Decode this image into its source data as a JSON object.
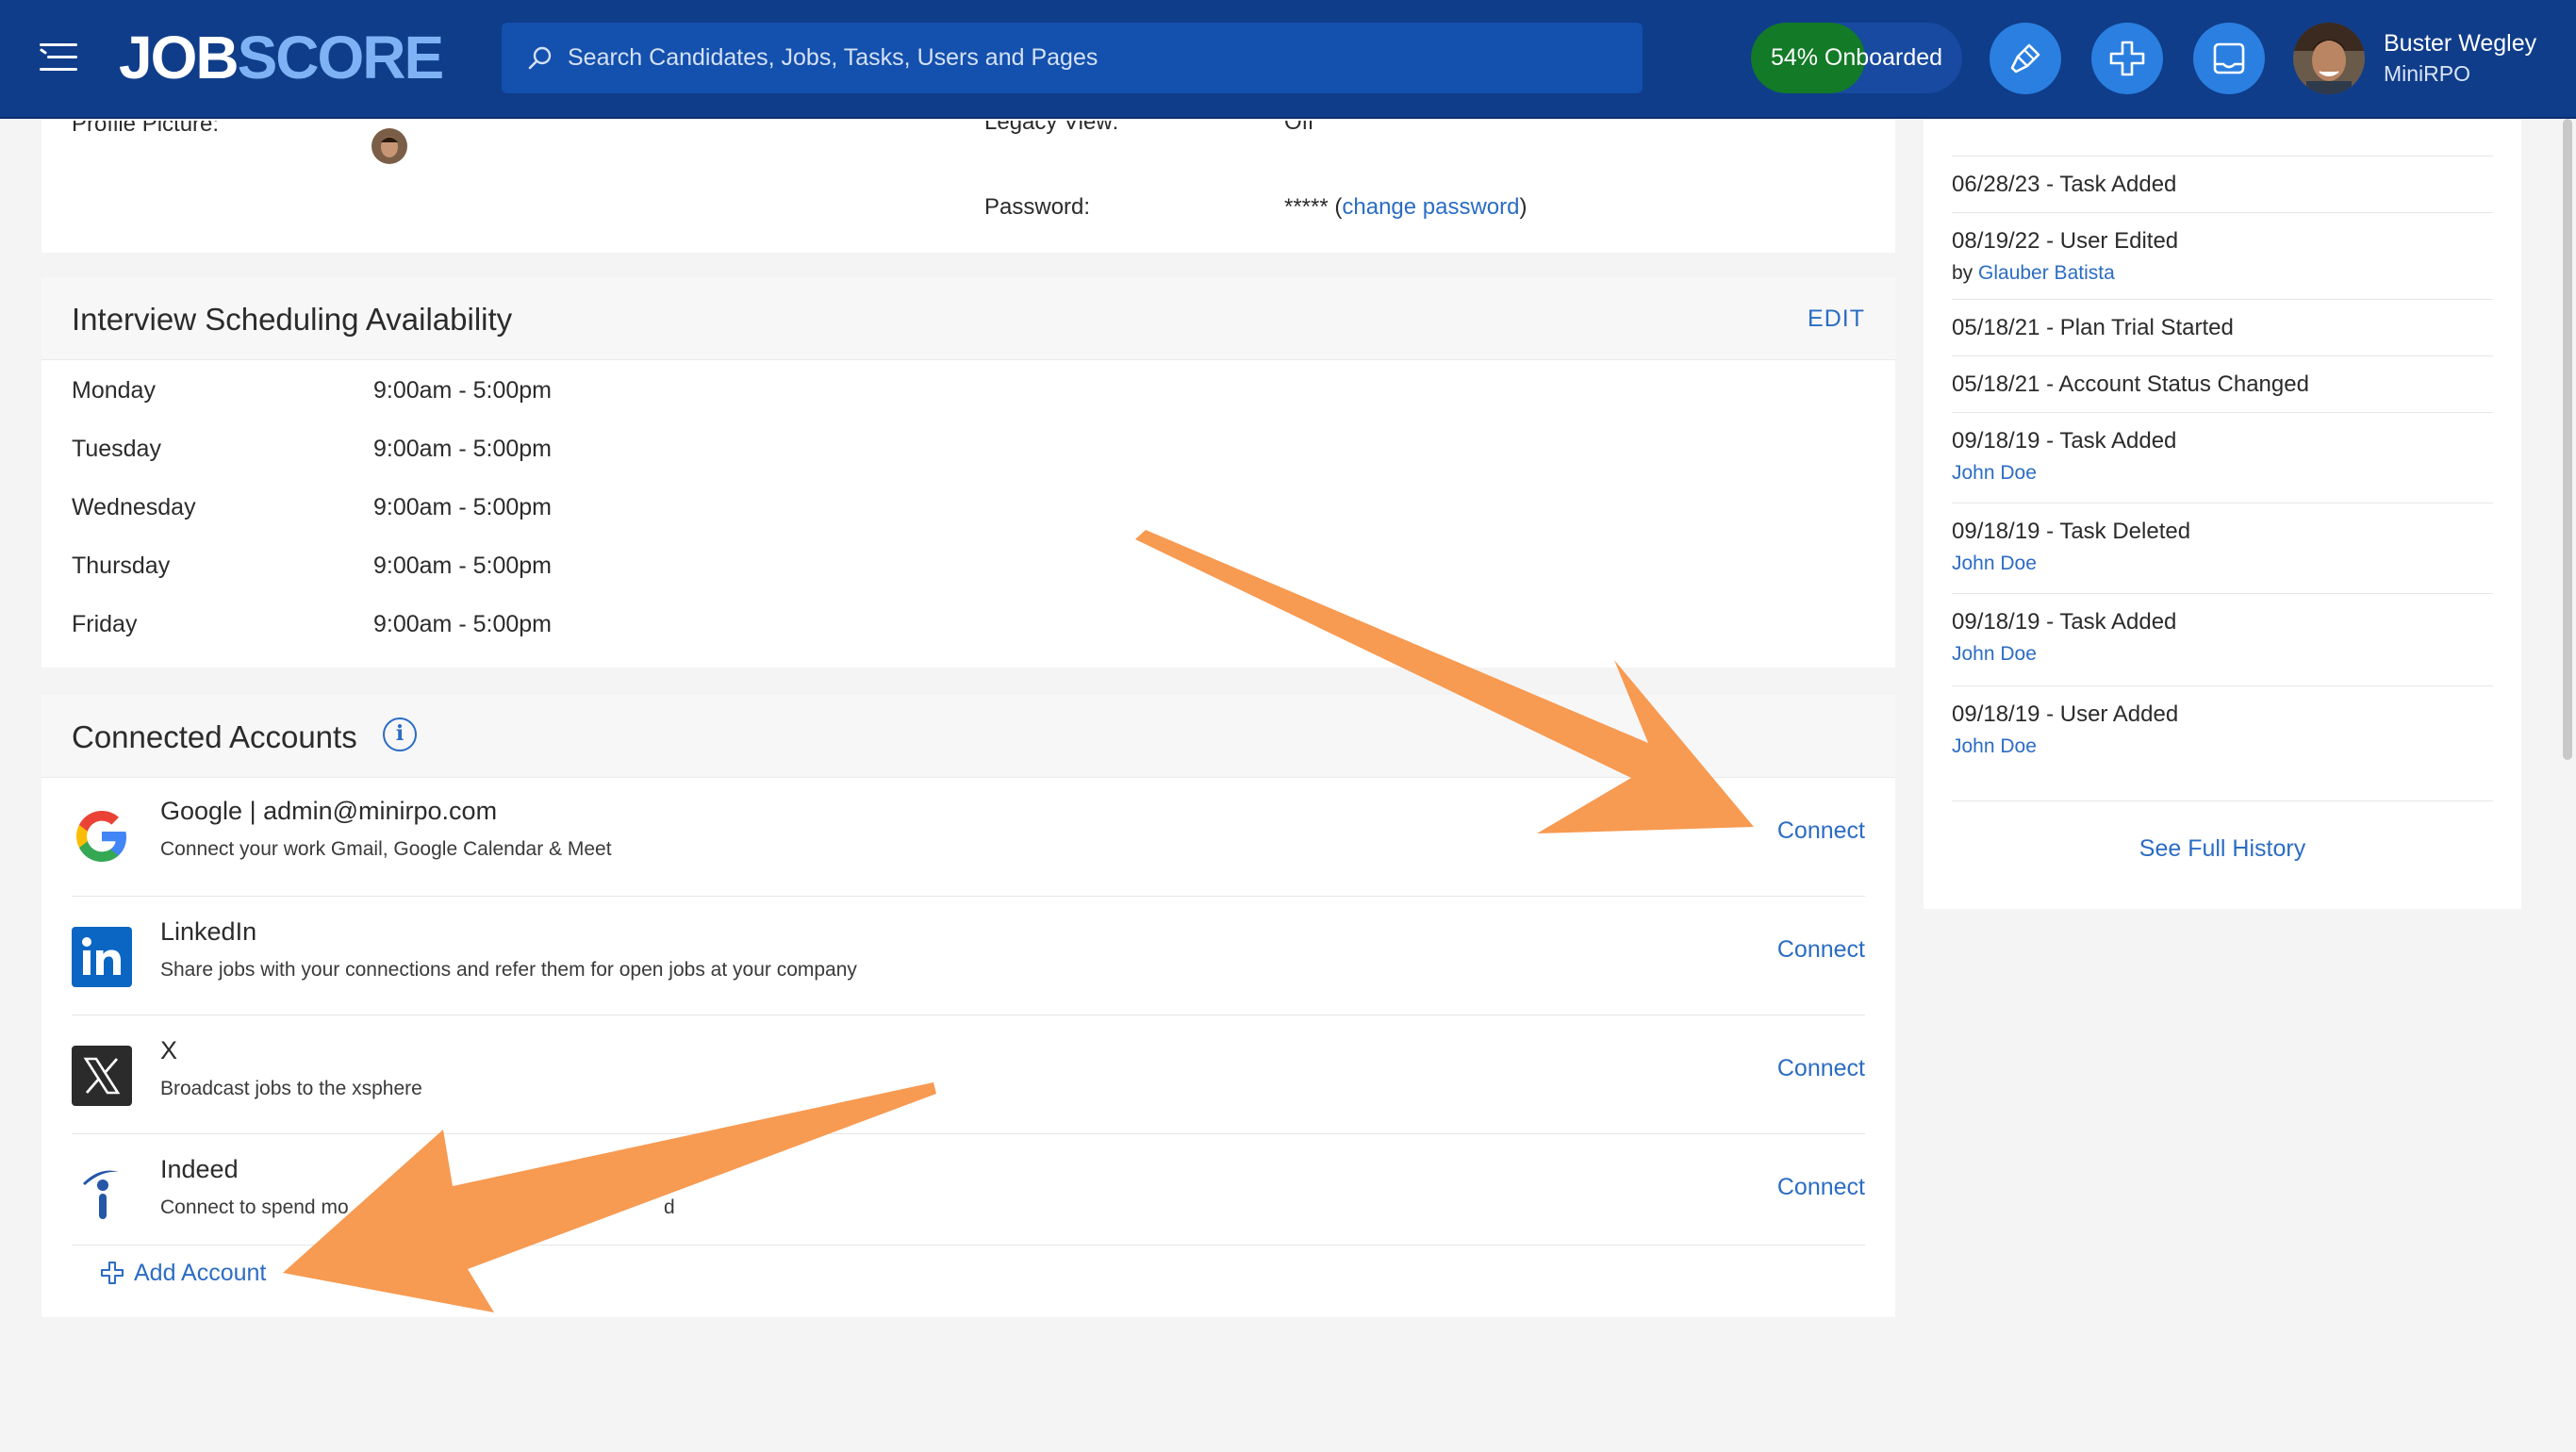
{
  "topbar": {
    "logo_part1": "JOB",
    "logo_part2": "SCORE",
    "search_placeholder": "Search Candidates, Jobs, Tasks, Users and Pages",
    "onboarded_label": "54% Onboarded",
    "onboarded_progress": 0.54,
    "user_name": "Buster Wegley",
    "user_org": "MiniRPO"
  },
  "profile": {
    "profile_picture_label": "Profile Picture:",
    "legacy_view_label": "Legacy View:",
    "legacy_view_value": "Off",
    "password_label": "Password:",
    "password_mask": "*****",
    "change_password_label": "change password"
  },
  "availability": {
    "title": "Interview Scheduling Availability",
    "edit_label": "EDIT",
    "days": [
      {
        "day": "Monday",
        "hours": "9:00am - 5:00pm"
      },
      {
        "day": "Tuesday",
        "hours": "9:00am - 5:00pm"
      },
      {
        "day": "Wednesday",
        "hours": "9:00am - 5:00pm"
      },
      {
        "day": "Thursday",
        "hours": "9:00am - 5:00pm"
      },
      {
        "day": "Friday",
        "hours": "9:00am - 5:00pm"
      }
    ]
  },
  "accounts": {
    "title": "Connected Accounts",
    "items": [
      {
        "name": "Google | admin@minirpo.com",
        "desc": "Connect your work Gmail, Google Calendar & Meet",
        "action": "Connect",
        "icon": "google-icon"
      },
      {
        "name": "LinkedIn",
        "desc": "Share jobs with your connections and refer them for open jobs at your company",
        "action": "Connect",
        "icon": "linkedin-icon"
      },
      {
        "name": "X",
        "desc": "Broadcast jobs to the xsphere",
        "action": "Connect",
        "icon": "x-icon"
      },
      {
        "name": "Indeed",
        "desc": "Connect to spend mo",
        "desc_tail": "d",
        "action": "Connect",
        "icon": "indeed-icon"
      }
    ],
    "add_label": "Add Account"
  },
  "history": {
    "items": [
      {
        "event": "06/28/23 - Task Added",
        "by_prefix": "",
        "actor": ""
      },
      {
        "event": "08/19/22 - User Edited",
        "by_prefix": "by ",
        "actor": "Glauber Batista"
      },
      {
        "event": "05/18/21 - Plan Trial Started",
        "by_prefix": "",
        "actor": ""
      },
      {
        "event": "05/18/21 - Account Status Changed",
        "by_prefix": "",
        "actor": ""
      },
      {
        "event": "09/18/19 - Task Added",
        "by_prefix": "",
        "actor": "John Doe"
      },
      {
        "event": "09/18/19 - Task Deleted",
        "by_prefix": "",
        "actor": "John Doe"
      },
      {
        "event": "09/18/19 - Task Added",
        "by_prefix": "",
        "actor": "John Doe"
      },
      {
        "event": "09/18/19 - User Added",
        "by_prefix": "",
        "actor": "John Doe"
      }
    ],
    "see_full_label": "See Full History"
  },
  "colors": {
    "nav_bg": "#0f3d8a",
    "accent": "#2b6cc4",
    "onboard_green": "#137a27",
    "arrow": "#f79a52"
  }
}
